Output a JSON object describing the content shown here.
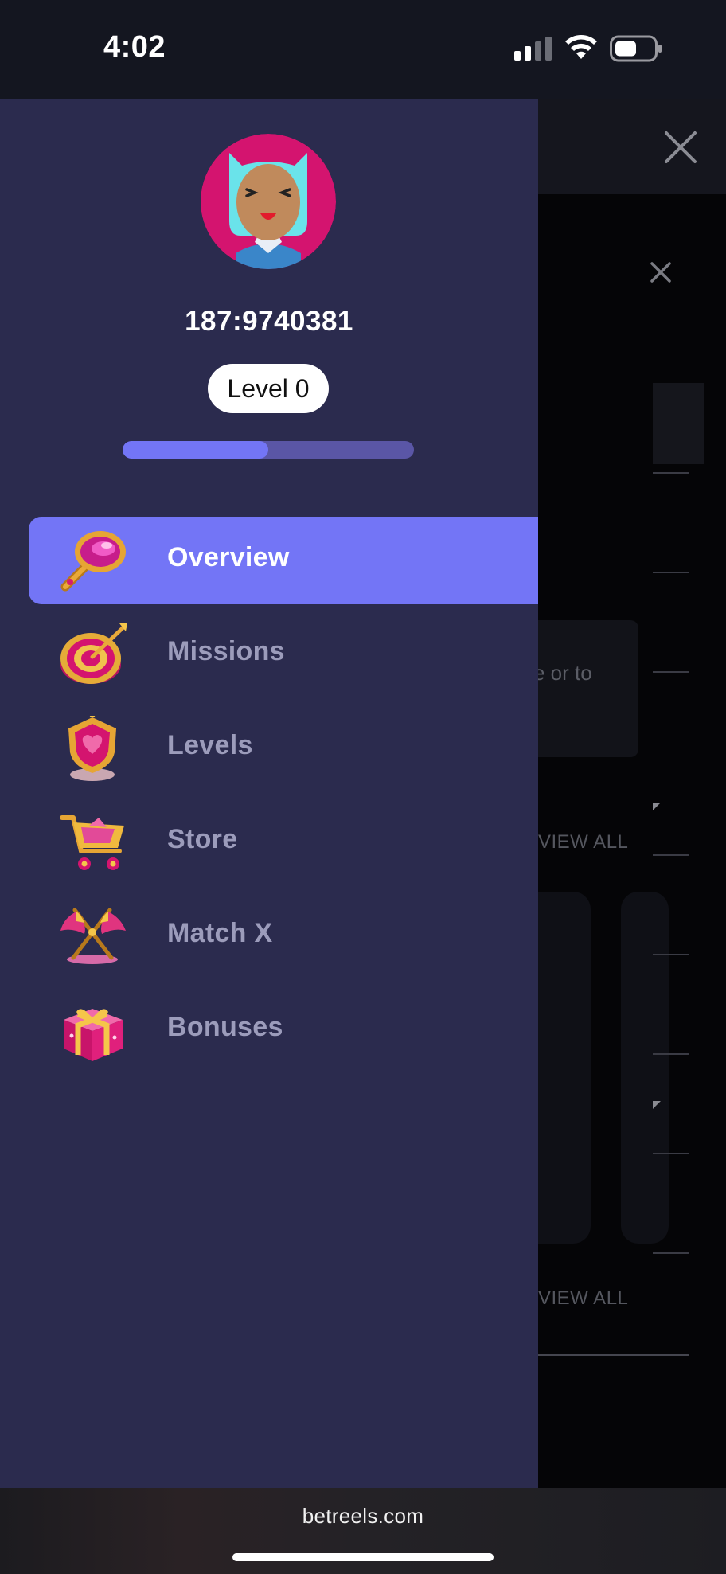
{
  "status_bar": {
    "time": "4:02"
  },
  "background_page": {
    "partial_text": "e or to",
    "view_all_1": "VIEW ALL",
    "view_all_2": "VIEW ALL"
  },
  "drawer": {
    "user_id": "187:9740381",
    "level_label": "Level 0",
    "progress_fraction": 0.5,
    "menu": [
      {
        "label": "Overview",
        "icon": "magnifier-icon",
        "active": true
      },
      {
        "label": "Missions",
        "icon": "target-icon",
        "active": false
      },
      {
        "label": "Levels",
        "icon": "shield-icon",
        "active": false
      },
      {
        "label": "Store",
        "icon": "cart-icon",
        "active": false
      },
      {
        "label": "Match X",
        "icon": "crossed-flags-icon",
        "active": false
      },
      {
        "label": "Bonuses",
        "icon": "gift-icon",
        "active": false
      }
    ]
  },
  "browser": {
    "url": "betreels.com"
  },
  "colors": {
    "drawer_bg": "#2b2b4e",
    "accent": "#7375f6",
    "inactive_label": "#9c9cbb"
  }
}
